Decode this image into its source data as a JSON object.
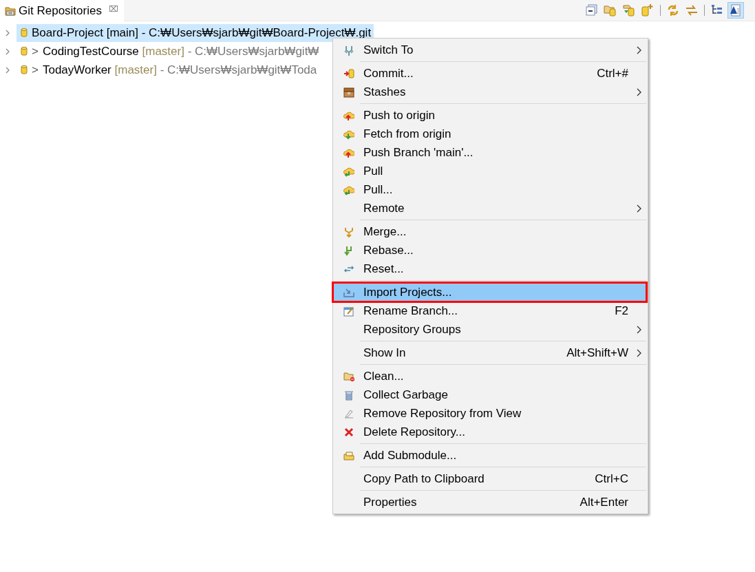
{
  "view_tab": {
    "title": "Git Repositories",
    "close": "⌧"
  },
  "toolbar": [
    {
      "selected": false
    },
    {
      "selected": false
    },
    {
      "selected": false
    },
    {
      "selected": false
    },
    {
      "selected": false
    },
    {
      "selected": false
    },
    {
      "selected": false
    },
    {
      "selected": true
    }
  ],
  "repositories": [
    {
      "name": "Board-Project",
      "branch": "[main]",
      "path": "- C:₩Users₩sjarb₩git₩Board-Project₩.git",
      "selected": true
    },
    {
      "name": "CodingTestCourse",
      "dirty_marker": ">",
      "branch": "[master]",
      "path": "- C:₩Users₩sjarb₩git₩",
      "selected": false
    },
    {
      "name": "TodayWorker",
      "dirty_marker": ">",
      "branch": "[master]",
      "path": "- C:₩Users₩sjarb₩git₩Toda",
      "selected": false
    }
  ],
  "context_menu": [
    {
      "kind": "item",
      "label": "Switch To",
      "submenu": true,
      "selected": false
    },
    {
      "kind": "separator"
    },
    {
      "kind": "item",
      "label": "Commit...",
      "shortcut": "Ctrl+#",
      "submenu": false,
      "selected": false
    },
    {
      "kind": "item",
      "label": "Stashes",
      "submenu": true,
      "selected": false
    },
    {
      "kind": "separator"
    },
    {
      "kind": "item",
      "label": "Push to origin",
      "submenu": false,
      "selected": false
    },
    {
      "kind": "item",
      "label": "Fetch from origin",
      "submenu": false,
      "selected": false
    },
    {
      "kind": "item",
      "label": "Push Branch 'main'...",
      "submenu": false,
      "selected": false
    },
    {
      "kind": "item",
      "label": "Pull",
      "submenu": false,
      "selected": false
    },
    {
      "kind": "item",
      "label": "Pull...",
      "submenu": false,
      "selected": false
    },
    {
      "kind": "item",
      "label": "Remote",
      "submenu": true,
      "selected": false
    },
    {
      "kind": "separator"
    },
    {
      "kind": "item",
      "label": "Merge...",
      "submenu": false,
      "selected": false
    },
    {
      "kind": "item",
      "label": "Rebase...",
      "submenu": false,
      "selected": false
    },
    {
      "kind": "item",
      "label": "Reset...",
      "submenu": false,
      "selected": false
    },
    {
      "kind": "separator"
    },
    {
      "kind": "item",
      "label": "Import Projects...",
      "submenu": false,
      "selected": true,
      "outlined": true
    },
    {
      "kind": "item",
      "label": "Rename Branch...",
      "shortcut": "F2",
      "submenu": false,
      "selected": false
    },
    {
      "kind": "item",
      "label": "Repository Groups",
      "submenu": true,
      "selected": false
    },
    {
      "kind": "separator"
    },
    {
      "kind": "item",
      "label": "Show In",
      "shortcut": "Alt+Shift+W",
      "submenu": true,
      "selected": false
    },
    {
      "kind": "separator"
    },
    {
      "kind": "item",
      "label": "Clean...",
      "submenu": false,
      "selected": false
    },
    {
      "kind": "item",
      "label": "Collect Garbage",
      "submenu": false,
      "selected": false
    },
    {
      "kind": "item",
      "label": "Remove Repository from View",
      "submenu": false,
      "selected": false
    },
    {
      "kind": "item",
      "label": "Delete Repository...",
      "submenu": false,
      "selected": false
    },
    {
      "kind": "separator"
    },
    {
      "kind": "item",
      "label": "Add Submodule...",
      "submenu": false,
      "selected": false
    },
    {
      "kind": "separator"
    },
    {
      "kind": "item",
      "label": "Copy Path to Clipboard",
      "shortcut": "Ctrl+C",
      "submenu": false,
      "selected": false
    },
    {
      "kind": "separator"
    },
    {
      "kind": "item",
      "label": "Properties",
      "shortcut": "Alt+Enter",
      "submenu": false,
      "selected": false
    }
  ]
}
